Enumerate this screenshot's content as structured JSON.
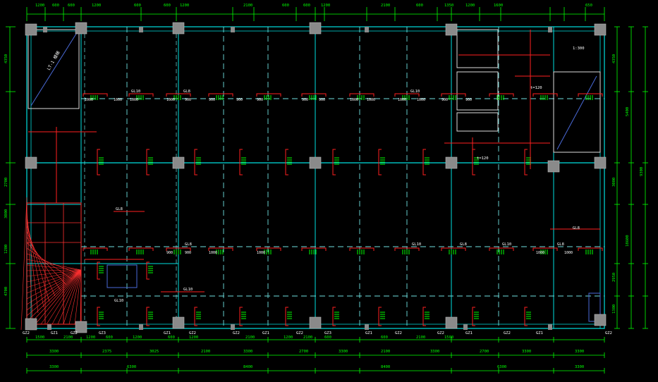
{
  "colors": {
    "background": "#000000",
    "grid": "#00e0e0",
    "beam_dash": "#6fe0e0",
    "dimension": "#00ff00",
    "rebar": "#ff2020",
    "label": "#ffffff",
    "column": "#8a8a8a",
    "hatch": "#ff3030",
    "opening": "#4a6ad8"
  },
  "top_dims": [
    "1200",
    "600",
    "600",
    "1200",
    "600",
    "600",
    "1200",
    "2100",
    "600",
    "600",
    "1200",
    "2100",
    "600",
    "1350",
    "1200",
    "1600",
    "650"
  ],
  "bottom_dims_row1": [
    "1500",
    "2100",
    "1200",
    "600",
    "1200",
    "600",
    "1200",
    "2100",
    "1200",
    "2100",
    "600",
    "600",
    "2100",
    "1500"
  ],
  "bottom_dims_row2": [
    "3300",
    "2375",
    "3025",
    "2100",
    "3300",
    "2700",
    "3300",
    "2100",
    "3300",
    "2700",
    "3300",
    "3300"
  ],
  "bottom_dims_row3": [
    "3300",
    "6300",
    "8400",
    "8400",
    "6300",
    "3300"
  ],
  "left_dims": [
    "4350",
    "2700",
    "3000",
    "1200",
    "4700"
  ],
  "right_dims": [
    "4350",
    "5400",
    "9300",
    "3000",
    "2950",
    "1300",
    "18600"
  ],
  "column_labels": [
    "GZ2",
    "GZ1",
    "GZ2",
    "GZ3",
    "GZ1",
    "GZ2",
    "GZ2",
    "GZ1",
    "GZ2",
    "GZ3",
    "GZ1",
    "GZ2",
    "GZ2",
    "GZ1",
    "GZ2",
    "GZ1",
    "GZ2"
  ],
  "beam_labels": [
    "GL10",
    "GL8",
    "GL10",
    "GL8",
    "GL8",
    "GL10",
    "GL8",
    "GL10",
    "GL8",
    "GL10",
    "GL10",
    "GL8"
  ],
  "rebar_values": [
    "1000",
    "1000",
    "1000",
    "1000",
    "900",
    "900",
    "900",
    "900",
    "900",
    "900",
    "1000",
    "1000",
    "1000",
    "1000",
    "900",
    "900",
    "900",
    "900",
    "1000",
    "1000",
    "1000",
    "1000"
  ],
  "stair_label": "LT-1 楼梯",
  "notes": [
    "t=120",
    "1:300",
    "t=120"
  ]
}
